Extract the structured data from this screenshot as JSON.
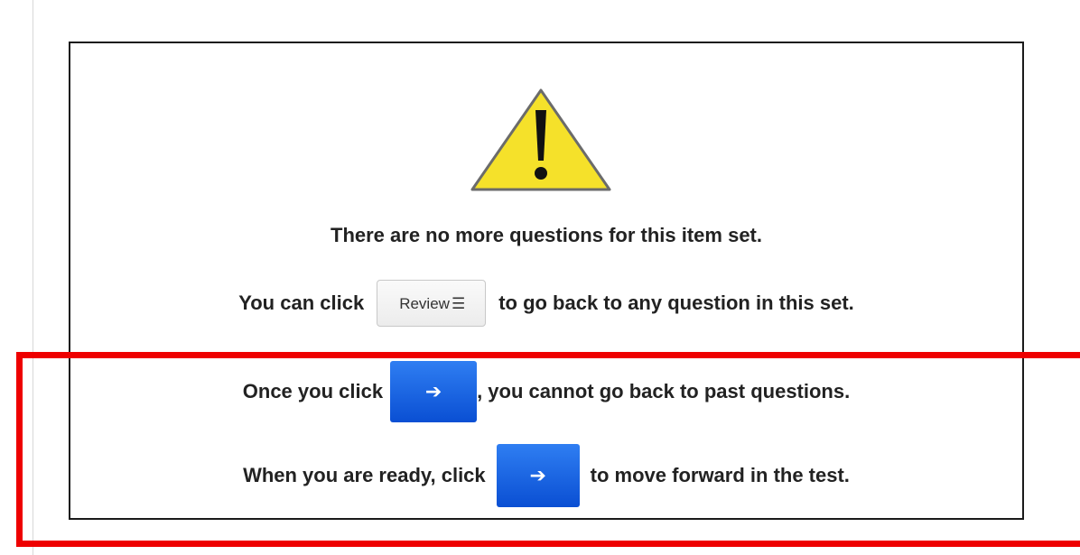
{
  "dialog": {
    "icon": "warning-icon",
    "message_no_more": "There are no more questions for this item set.",
    "review_line": {
      "before": "You can click",
      "button_label": "Review",
      "button_icon": "list-icon",
      "after": "to go back to any question in this set."
    },
    "once_line": {
      "before": "Once you click",
      "button_icon": "arrow-right-icon",
      "after": ", you cannot go back to past questions."
    },
    "ready_line": {
      "before": "When you are ready, click",
      "button_icon": "arrow-right-icon",
      "after": "to move forward in the test."
    }
  },
  "colors": {
    "highlight": "#ee0000",
    "next_button": "#1560e0",
    "warning_fill": "#f5e12a"
  }
}
